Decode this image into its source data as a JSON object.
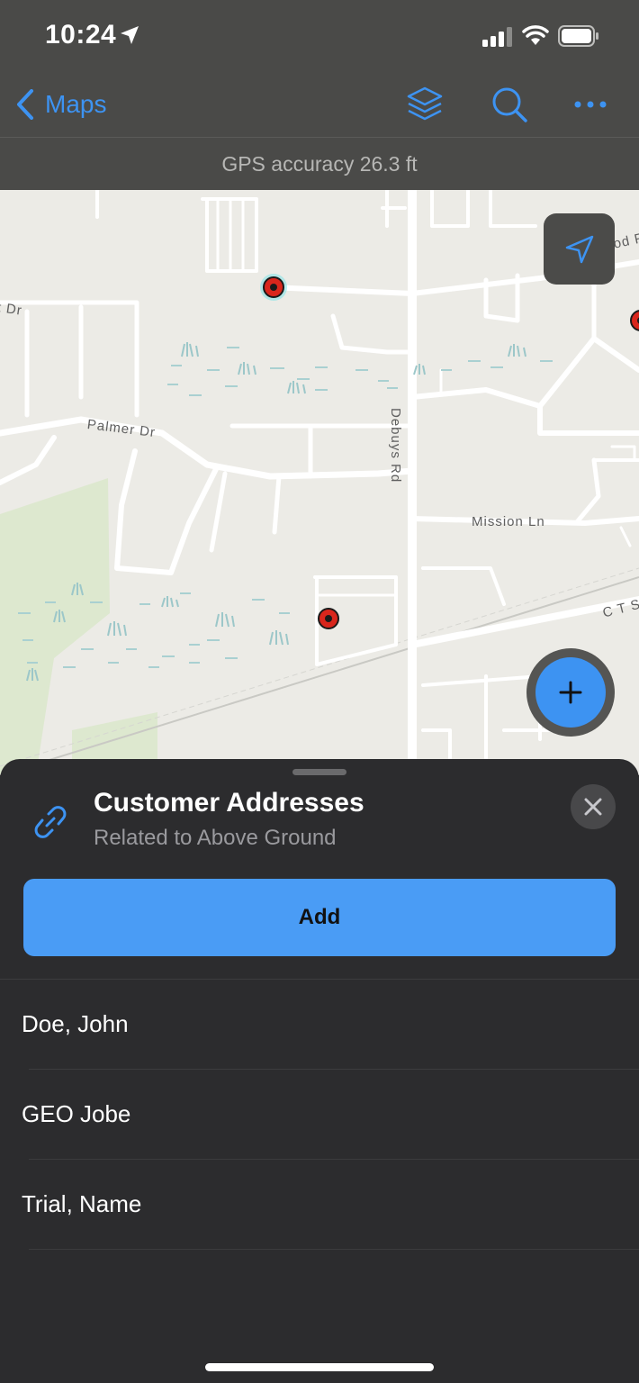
{
  "status_bar": {
    "time": "10:24"
  },
  "nav": {
    "back_label": "Maps",
    "icons": [
      "chevron-left-icon",
      "layers-icon",
      "search-icon",
      "more-icon"
    ]
  },
  "gps": {
    "accuracy_text": "GPS accuracy 26.3 ft"
  },
  "map": {
    "labels": {
      "palmer": "Palmer Dr",
      "debuys": "Debuys Rd",
      "mission": "Mission Ln",
      "cts": "C T S",
      "dr_left": "t Dr",
      "od": "od F"
    },
    "icons": [
      "locate-icon",
      "plus-icon"
    ]
  },
  "sheet": {
    "title": "Customer Addresses",
    "subtitle": "Related to Above Ground",
    "add_label": "Add",
    "close_icon": "close-icon",
    "link_icon": "link-icon",
    "records": [
      "Doe, John",
      "GEO Jobe",
      "Trial, Name"
    ]
  },
  "colors": {
    "accent": "#3d93f2",
    "toolbar": "#4a4a48",
    "sheet": "#2c2c2e",
    "map_background": "#ecebe6",
    "marker": "#d9261c"
  }
}
